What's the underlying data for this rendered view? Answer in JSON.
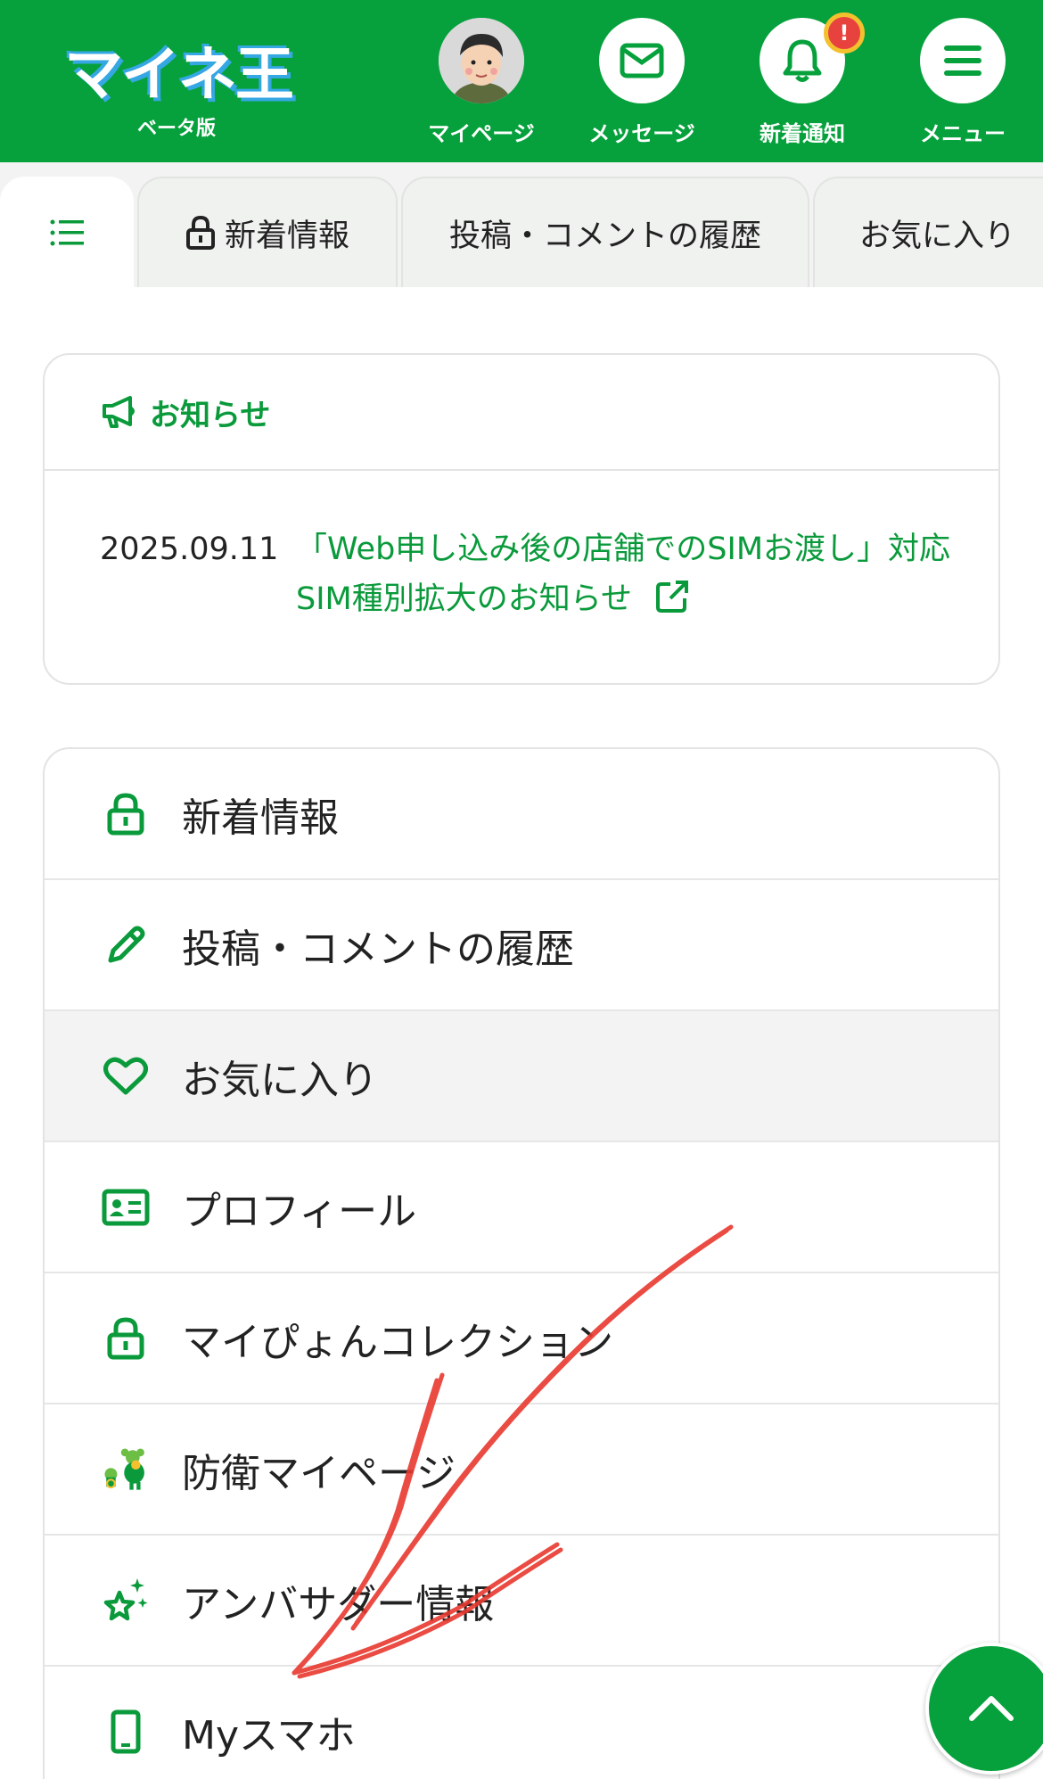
{
  "header": {
    "logo_text": "マイネ王",
    "logo_sub": "ベータ版",
    "nav": [
      {
        "label": "マイページ"
      },
      {
        "label": "メッセージ"
      },
      {
        "label": "新着通知",
        "badge": "!"
      },
      {
        "label": "メニュー"
      }
    ]
  },
  "tabs": [
    {
      "label": "",
      "icon": "list-icon",
      "active": true
    },
    {
      "label": "新着情報",
      "icon": "lock-icon"
    },
    {
      "label": "投稿・コメントの履歴"
    },
    {
      "label": "お気に入り"
    }
  ],
  "notice": {
    "title": "お知らせ",
    "date": "2025.09.11",
    "link_text": "「Web申し込み後の店舗でのSIMお渡し」対応SIM種別拡大のお知らせ"
  },
  "menu": [
    {
      "label": "新着情報",
      "icon": "lock-icon"
    },
    {
      "label": "投稿・コメントの履歴",
      "icon": "pencil-icon"
    },
    {
      "label": "お気に入り",
      "icon": "heart-icon",
      "highlighted": true
    },
    {
      "label": "プロフィール",
      "icon": "id-card-icon"
    },
    {
      "label": "マイぴょんコレクション",
      "icon": "lock-icon"
    },
    {
      "label": "防衛マイページ",
      "icon": "mascot-icon"
    },
    {
      "label": "アンバサダー情報",
      "icon": "sparkle-star-icon"
    },
    {
      "label": "Myスマホ",
      "icon": "smartphone-icon"
    }
  ],
  "colors": {
    "brand_green": "#06a13c",
    "link_green": "#0a9a3b",
    "badge_red": "#e8423e",
    "annotation_red": "#e8392f"
  }
}
